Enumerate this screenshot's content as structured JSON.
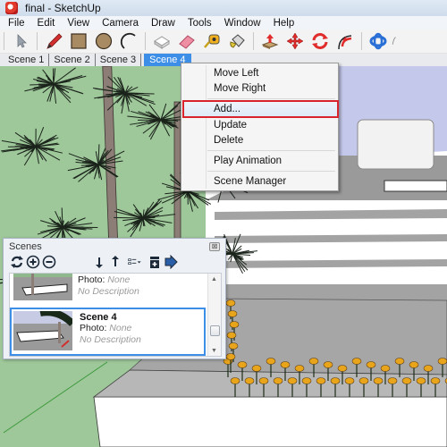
{
  "window": {
    "title": "final - SketchUp",
    "app_icon": "sketchup-logo-icon"
  },
  "menubar": {
    "items": [
      {
        "label": "File"
      },
      {
        "label": "Edit"
      },
      {
        "label": "View"
      },
      {
        "label": "Camera"
      },
      {
        "label": "Draw"
      },
      {
        "label": "Tools"
      },
      {
        "label": "Window"
      },
      {
        "label": "Help"
      }
    ]
  },
  "toolbar": {
    "tools": [
      {
        "name": "select",
        "icon": "arrow-cursor-icon"
      },
      {
        "name": "line",
        "icon": "pencil-icon"
      },
      {
        "name": "rectangle",
        "icon": "rectangle-icon"
      },
      {
        "name": "circle",
        "icon": "circle-icon"
      },
      {
        "name": "arc",
        "icon": "arc-icon"
      },
      {
        "name": "make-component",
        "icon": "component-icon"
      },
      {
        "name": "eraser",
        "icon": "eraser-icon"
      },
      {
        "name": "tape-measure",
        "icon": "tape-measure-icon"
      },
      {
        "name": "paint-bucket",
        "icon": "paint-bucket-icon"
      },
      {
        "name": "push-pull",
        "icon": "push-pull-icon"
      },
      {
        "name": "move",
        "icon": "move-icon"
      },
      {
        "name": "rotate",
        "icon": "rotate-icon"
      },
      {
        "name": "follow-me",
        "icon": "follow-me-icon"
      },
      {
        "name": "orbit",
        "icon": "orbit-icon"
      }
    ]
  },
  "scene_tabs": [
    {
      "label": "Scene 1",
      "active": false
    },
    {
      "label": "Scene 2",
      "active": false
    },
    {
      "label": "Scene 3",
      "active": false
    },
    {
      "label": "Scene 4",
      "active": true
    }
  ],
  "context_menu": {
    "items": [
      {
        "label": "Move Left"
      },
      {
        "label": "Move Right"
      },
      {
        "label": "Add...",
        "highlighted": true
      },
      {
        "label": "Update"
      },
      {
        "label": "Delete"
      },
      {
        "label": "Play Animation"
      },
      {
        "label": "Scene Manager"
      }
    ],
    "highlight_color": "#d9232d"
  },
  "scenes_panel": {
    "title": "Scenes",
    "close_glyph": "⊠",
    "toolbar": [
      {
        "name": "update-scene",
        "icon": "refresh-icon"
      },
      {
        "name": "add-scene",
        "icon": "plus-circle-icon"
      },
      {
        "name": "remove-scene",
        "icon": "minus-circle-icon"
      },
      {
        "name": "move-scene-down",
        "icon": "arrow-down-icon"
      },
      {
        "name": "move-scene-up",
        "icon": "arrow-up-icon"
      },
      {
        "name": "view-options",
        "icon": "list-view-icon"
      },
      {
        "name": "show-details",
        "icon": "details-icon"
      },
      {
        "name": "expand",
        "icon": "expand-arrow-icon"
      }
    ],
    "entries": [
      {
        "name": "",
        "photo_label": "Photo",
        "photo_value": "None",
        "description": "No Description",
        "selected": false
      },
      {
        "name": "Scene 4",
        "photo_label": "Photo:",
        "photo_value": " None",
        "description": "No Description",
        "selected": true
      }
    ]
  },
  "colors": {
    "accent": "#3d8ee6",
    "grass": "#9ec79a",
    "sky": "#c4c8ea",
    "flower": "#e8a51c",
    "highlight_box": "#d9232d"
  }
}
